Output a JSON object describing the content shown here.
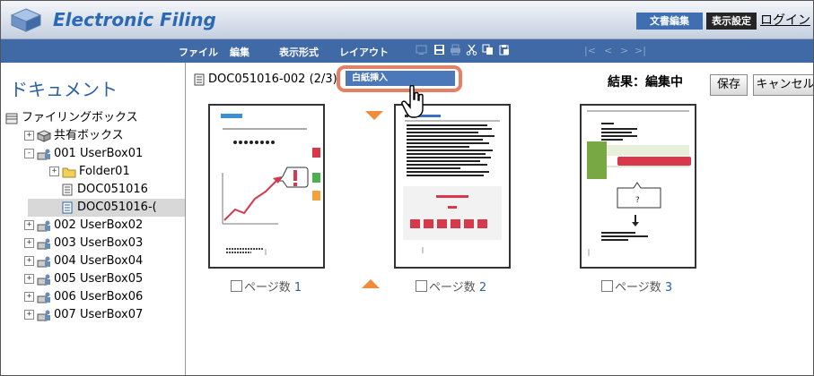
{
  "app": {
    "title": "Electronic Filing",
    "header_buttons": [
      "文書編集",
      "表示設定"
    ],
    "login_label": "ログイン"
  },
  "menu": {
    "items": [
      "ファイル",
      "編集",
      "表示形式",
      "レイアウト"
    ]
  },
  "sidebar": {
    "heading": "ドキュメント",
    "tree": [
      {
        "label": "ファイリングボックス",
        "icon": "filing-box-icon"
      },
      {
        "label": "共有ボックス",
        "icon": "shared-box-icon"
      },
      {
        "label": "001 UserBox01",
        "icon": "user-box-icon"
      },
      {
        "label": "Folder01",
        "icon": "folder-icon"
      },
      {
        "label": "DOC051016",
        "icon": "document-icon"
      },
      {
        "label": "DOC051016-(",
        "icon": "document-icon",
        "selected": true
      },
      {
        "label": "002 UserBox02",
        "icon": "user-box-icon"
      },
      {
        "label": "003 UserBox03",
        "icon": "user-box-icon"
      },
      {
        "label": "004 UserBox04",
        "icon": "user-box-icon"
      },
      {
        "label": "005 UserBox05",
        "icon": "user-box-icon"
      },
      {
        "label": "006 UserBox06",
        "icon": "user-box-icon"
      },
      {
        "label": "007 UserBox07",
        "icon": "user-box-icon"
      }
    ]
  },
  "document": {
    "name": "DOC051016-002",
    "page_indicator": "(2/3)",
    "status": "結果：編集中"
  },
  "actions": {
    "save": "保存",
    "cancel": "キャンセル"
  },
  "context_menu": {
    "item": "白紙挿入"
  },
  "pages": [
    {
      "label": "ページ数",
      "number": "1"
    },
    {
      "label": "ページ数",
      "number": "2"
    },
    {
      "label": "ページ数",
      "number": "3"
    }
  ],
  "colors": {
    "menubar": "#3f6aa6",
    "accent": "#2b5fa8",
    "highlight": "#e77f64",
    "insert_arrow": "#f08b3c"
  }
}
